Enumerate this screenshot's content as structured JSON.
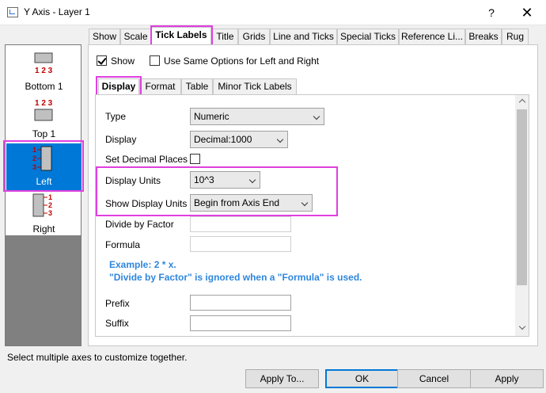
{
  "window": {
    "title": "Y Axis - Layer 1",
    "help_label": "?",
    "close_label": "✕"
  },
  "axis_list": [
    {
      "name": "Bottom 1",
      "ticks": "1 2 3"
    },
    {
      "name": "Top 1",
      "ticks": "1 2 3"
    },
    {
      "name": "Left",
      "ticks": "1 2 3",
      "selected": true
    },
    {
      "name": "Right",
      "ticks": "1 2 3"
    }
  ],
  "tabs": [
    "Show",
    "Scale",
    "Tick Labels",
    "Title",
    "Grids",
    "Line and Ticks",
    "Special Ticks",
    "Reference Li...",
    "Breaks",
    "Rug"
  ],
  "active_tab": "Tick Labels",
  "options": {
    "show_label": "Show",
    "show_checked": true,
    "same_options_label": "Use Same Options for Left and Right",
    "same_options_checked": false
  },
  "inner_tabs": [
    "Display",
    "Format",
    "Table",
    "Minor Tick Labels"
  ],
  "active_inner_tab": "Display",
  "form": {
    "type_label": "Type",
    "type_value": "Numeric",
    "display_label": "Display",
    "display_value": "Decimal:1000",
    "decimal_label": "Set Decimal Places",
    "decimal_checked": false,
    "units_label": "Display Units",
    "units_value": "10^3",
    "show_units_label": "Show Display Units",
    "show_units_value": "Begin from Axis End",
    "divide_label": "Divide by Factor",
    "divide_value": "",
    "formula_label": "Formula",
    "formula_value": "",
    "note_line1": "Example: 2 * x.",
    "note_line2": "\"Divide by Factor\" is ignored when a \"Formula\" is used.",
    "prefix_label": "Prefix",
    "prefix_value": "",
    "suffix_label": "Suffix",
    "suffix_value": ""
  },
  "status": "Select multiple axes to customize together.",
  "buttons": {
    "apply_to": "Apply To...",
    "ok": "OK",
    "cancel": "Cancel",
    "apply": "Apply"
  }
}
